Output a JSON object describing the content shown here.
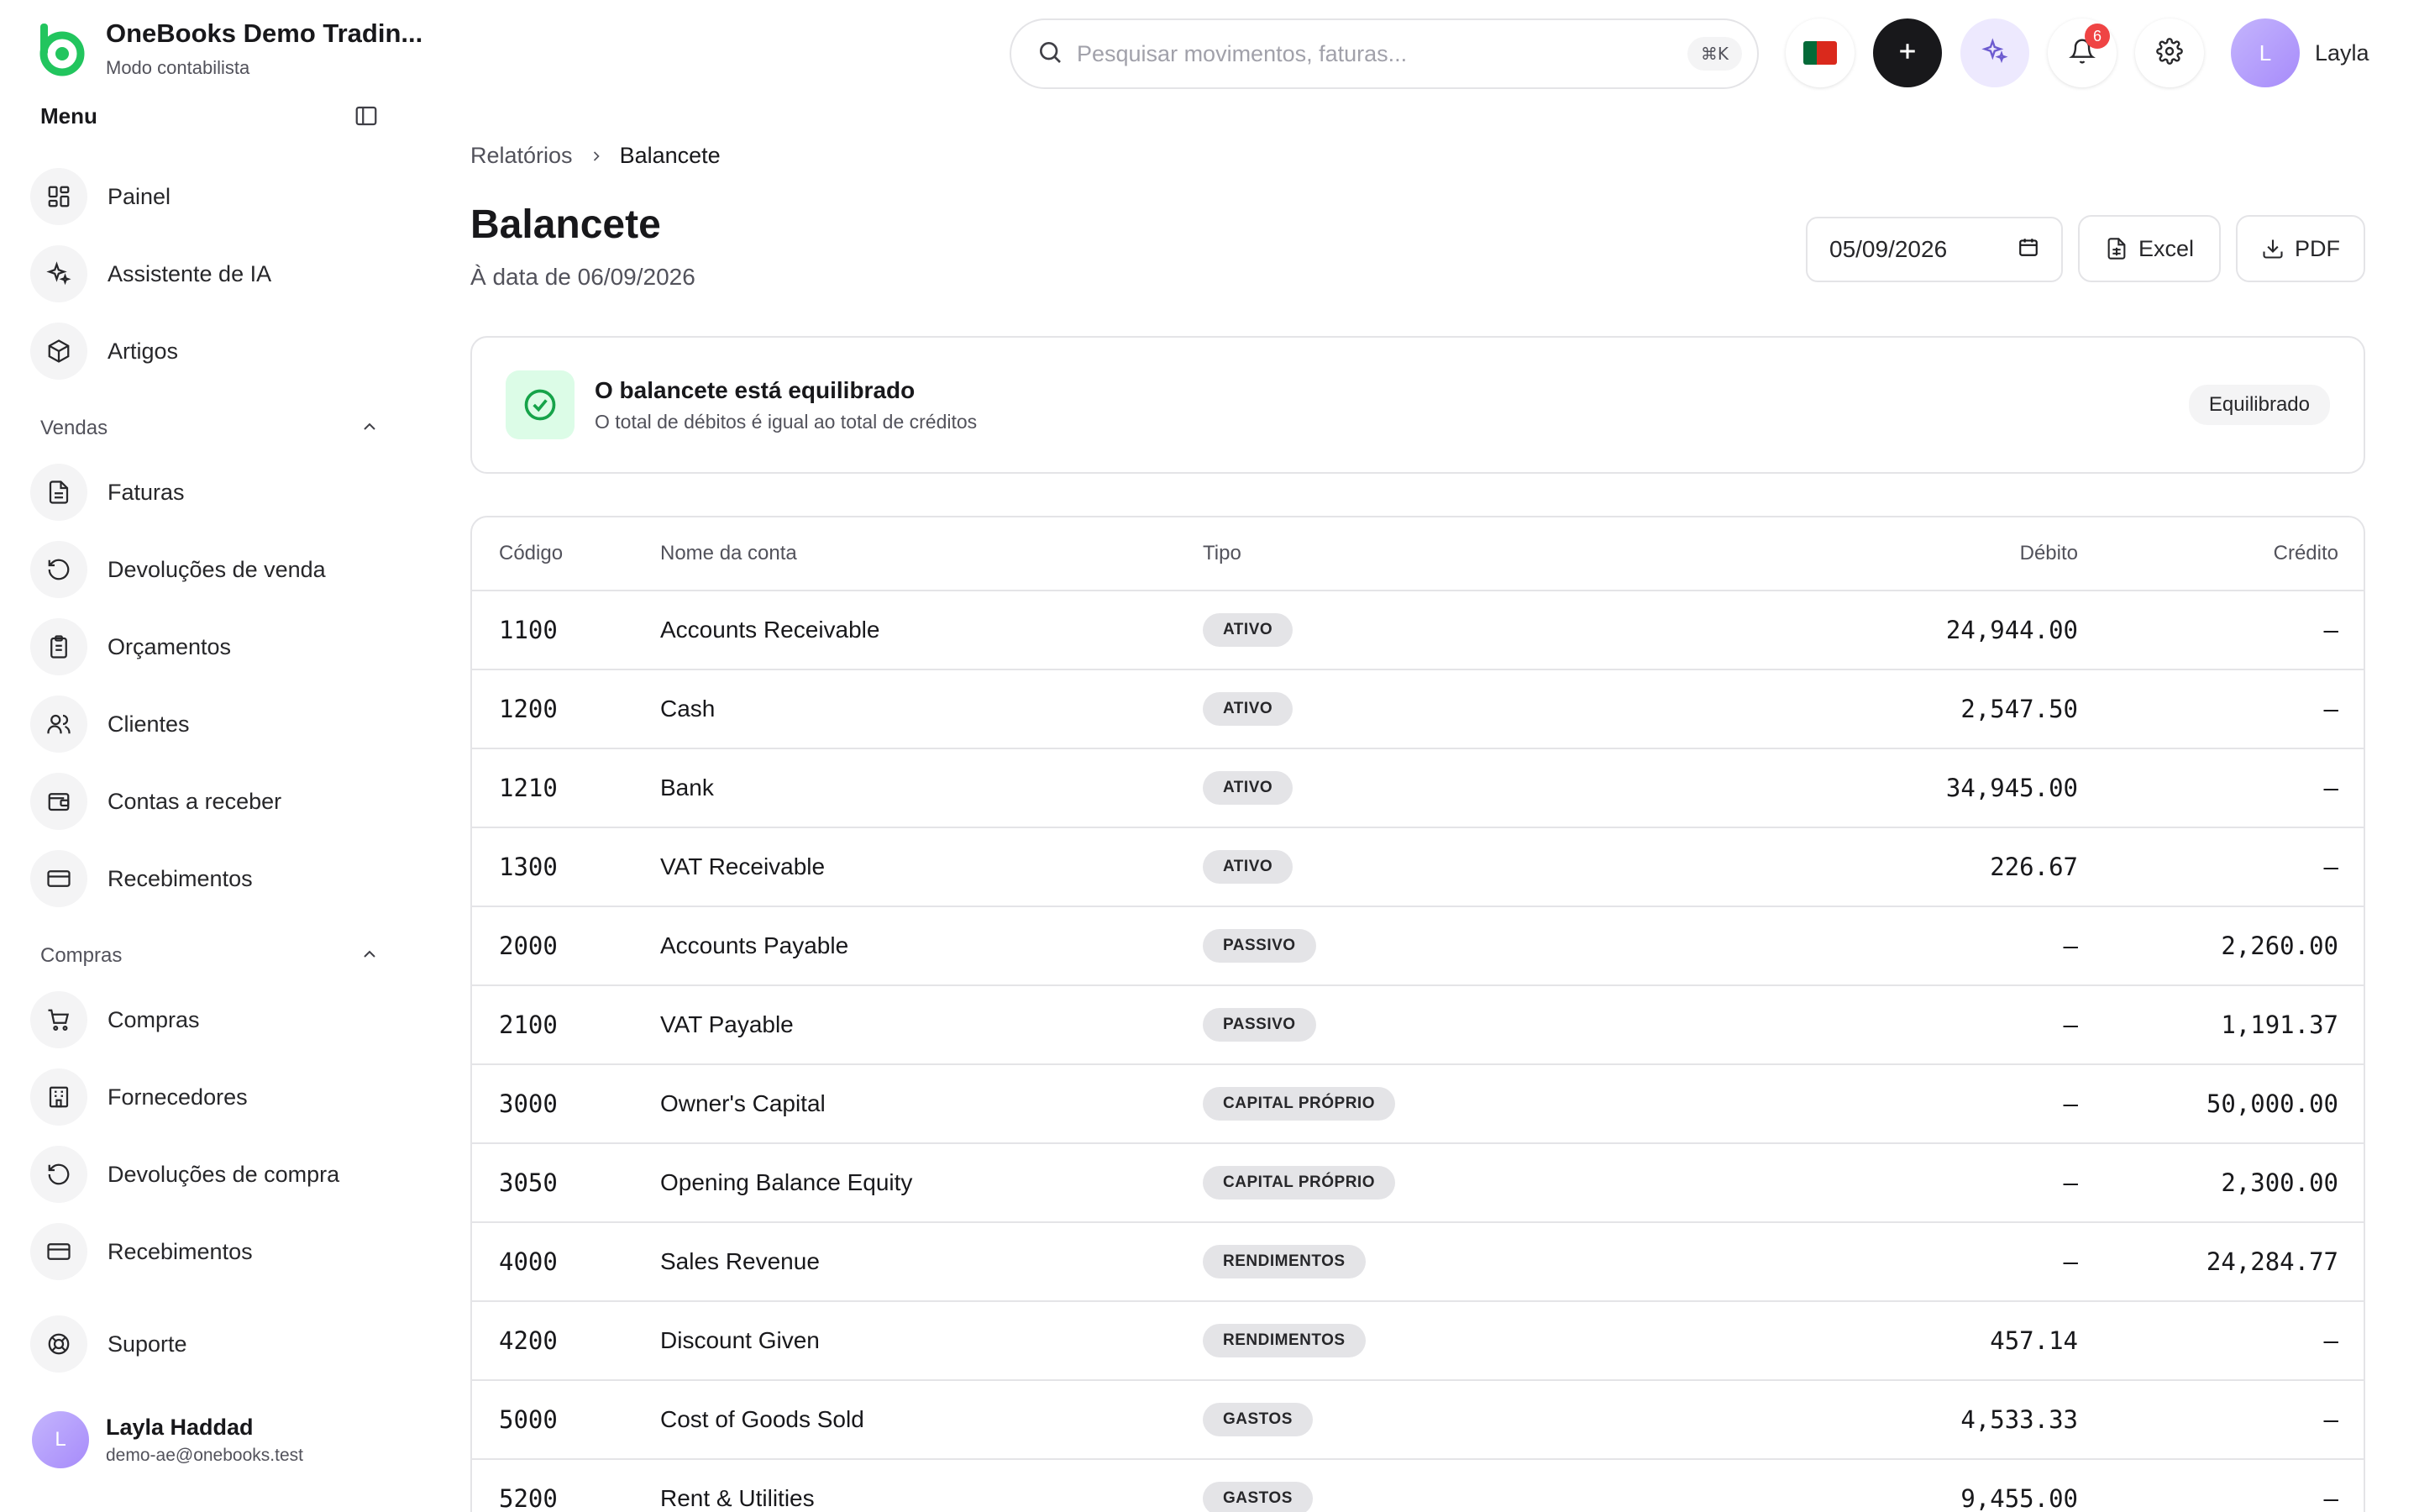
{
  "brand": {
    "name": "OneBooks Demo Tradin...",
    "subtitle": "Modo contabilista"
  },
  "sidebar": {
    "menu_title": "Menu",
    "items_top": [
      {
        "label": "Painel",
        "icon": "dashboard-icon"
      },
      {
        "label": "Assistente de IA",
        "icon": "sparkles-icon"
      },
      {
        "label": "Artigos",
        "icon": "box-icon"
      }
    ],
    "sales_section": "Vendas",
    "sales_items": [
      {
        "label": "Faturas",
        "icon": "file-text-icon"
      },
      {
        "label": "Devoluções de venda",
        "icon": "rotate-ccw-icon"
      },
      {
        "label": "Orçamentos",
        "icon": "clipboard-icon"
      },
      {
        "label": "Clientes",
        "icon": "users-icon"
      },
      {
        "label": "Contas a receber",
        "icon": "wallet-icon"
      },
      {
        "label": "Recebimentos",
        "icon": "credit-card-icon"
      }
    ],
    "purchases_section": "Compras",
    "purchases_items": [
      {
        "label": "Compras",
        "icon": "cart-icon"
      },
      {
        "label": "Fornecedores",
        "icon": "building-icon"
      },
      {
        "label": "Devoluções de compra",
        "icon": "rotate-ccw-icon"
      },
      {
        "label": "Recebimentos",
        "icon": "credit-card-icon"
      }
    ],
    "support_label": "Suporte",
    "user": {
      "initial": "L",
      "name": "Layla Haddad",
      "email": "demo-ae@onebooks.test"
    }
  },
  "topbar": {
    "search_placeholder": "Pesquisar movimentos, faturas...",
    "search_shortcut": "⌘K",
    "notification_count": "6",
    "profile_initial": "L",
    "profile_name": "Layla"
  },
  "breadcrumb": {
    "parent": "Relatórios",
    "current": "Balancete"
  },
  "page": {
    "title": "Balancete",
    "subtitle": "À data de 06/09/2026",
    "date_value": "05/09/2026",
    "excel_label": "Excel",
    "pdf_label": "PDF"
  },
  "status": {
    "title": "O balancete está equilibrado",
    "description": "O total de débitos é igual ao total de créditos",
    "badge": "Equilibrado"
  },
  "table": {
    "headers": {
      "code": "Código",
      "name": "Nome da conta",
      "type": "Tipo",
      "debit": "Débito",
      "credit": "Crédito"
    },
    "rows": [
      {
        "code": "1100",
        "name": "Accounts Receivable",
        "type": "ATIVO",
        "debit": "24,944.00",
        "credit": "–"
      },
      {
        "code": "1200",
        "name": "Cash",
        "type": "ATIVO",
        "debit": "2,547.50",
        "credit": "–"
      },
      {
        "code": "1210",
        "name": "Bank",
        "type": "ATIVO",
        "debit": "34,945.00",
        "credit": "–"
      },
      {
        "code": "1300",
        "name": "VAT Receivable",
        "type": "ATIVO",
        "debit": "226.67",
        "credit": "–"
      },
      {
        "code": "2000",
        "name": "Accounts Payable",
        "type": "PASSIVO",
        "debit": "–",
        "credit": "2,260.00"
      },
      {
        "code": "2100",
        "name": "VAT Payable",
        "type": "PASSIVO",
        "debit": "–",
        "credit": "1,191.37"
      },
      {
        "code": "3000",
        "name": "Owner's Capital",
        "type": "CAPITAL PRÓPRIO",
        "debit": "–",
        "credit": "50,000.00"
      },
      {
        "code": "3050",
        "name": "Opening Balance Equity",
        "type": "CAPITAL PRÓPRIO",
        "debit": "–",
        "credit": "2,300.00"
      },
      {
        "code": "4000",
        "name": "Sales Revenue",
        "type": "RENDIMENTOS",
        "debit": "–",
        "credit": "24,284.77"
      },
      {
        "code": "4200",
        "name": "Discount Given",
        "type": "RENDIMENTOS",
        "debit": "457.14",
        "credit": "–"
      },
      {
        "code": "5000",
        "name": "Cost of Goods Sold",
        "type": "GASTOS",
        "debit": "4,533.33",
        "credit": "–"
      },
      {
        "code": "5200",
        "name": "Rent & Utilities",
        "type": "GASTOS",
        "debit": "9,455.00",
        "credit": "–"
      }
    ]
  },
  "colors": {
    "accent_green": "#22c55e",
    "dark_button": "#18181b",
    "badge_red": "#ef4444",
    "avatar_purple": "#a78bfa"
  }
}
